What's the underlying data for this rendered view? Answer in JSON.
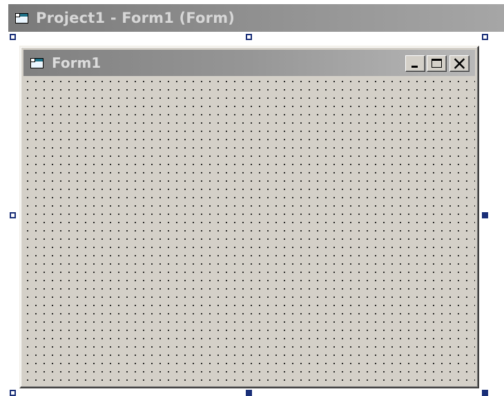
{
  "designer": {
    "title": "Project1 - Form1 (Form)",
    "icon": "form-icon"
  },
  "form": {
    "title": "Form1",
    "icon": "form-icon",
    "caption_buttons": [
      {
        "name": "minimize",
        "icon": "minimize-icon"
      },
      {
        "name": "maximize",
        "icon": "maximize-icon"
      },
      {
        "name": "close",
        "icon": "close-icon"
      }
    ],
    "background_color": "#d4d0c8",
    "grid_dot_color": "#000000"
  },
  "colors": {
    "handle": "#1a2f78",
    "titlebar_inactive": "#808080",
    "title_text": "#d7d7d7"
  }
}
